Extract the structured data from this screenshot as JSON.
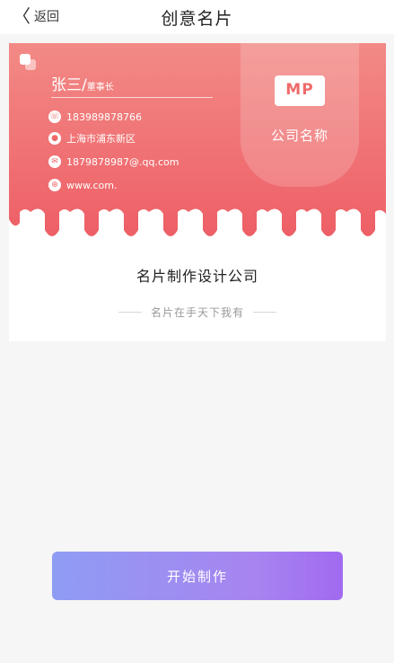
{
  "nav": {
    "back_icon": "chevron-left-icon",
    "back_glyph": "〈",
    "back_label": "返回",
    "title": "创意名片"
  },
  "card": {
    "colors": {
      "gradient_top": "#f28a86",
      "gradient_bottom": "#ee5f66",
      "accent": "#ef6a6a"
    },
    "logo_text": "MP",
    "company_name": "公司名称",
    "person_name": "张三/",
    "person_title": "董事长",
    "phone_icon": "phone-icon",
    "phone": "183989878766",
    "address_icon": "location-icon",
    "address": "上海市浦东新区",
    "email_icon": "email-icon",
    "email": "1879878987@.qq.com",
    "website_icon": "globe-icon",
    "website": "www.com.",
    "body_title": "名片制作设计公司",
    "slogan": "名片在手天下我有"
  },
  "action": {
    "start_label": "开始制作",
    "gradient_start": "#8f9cf4",
    "gradient_end": "#a16af0"
  }
}
